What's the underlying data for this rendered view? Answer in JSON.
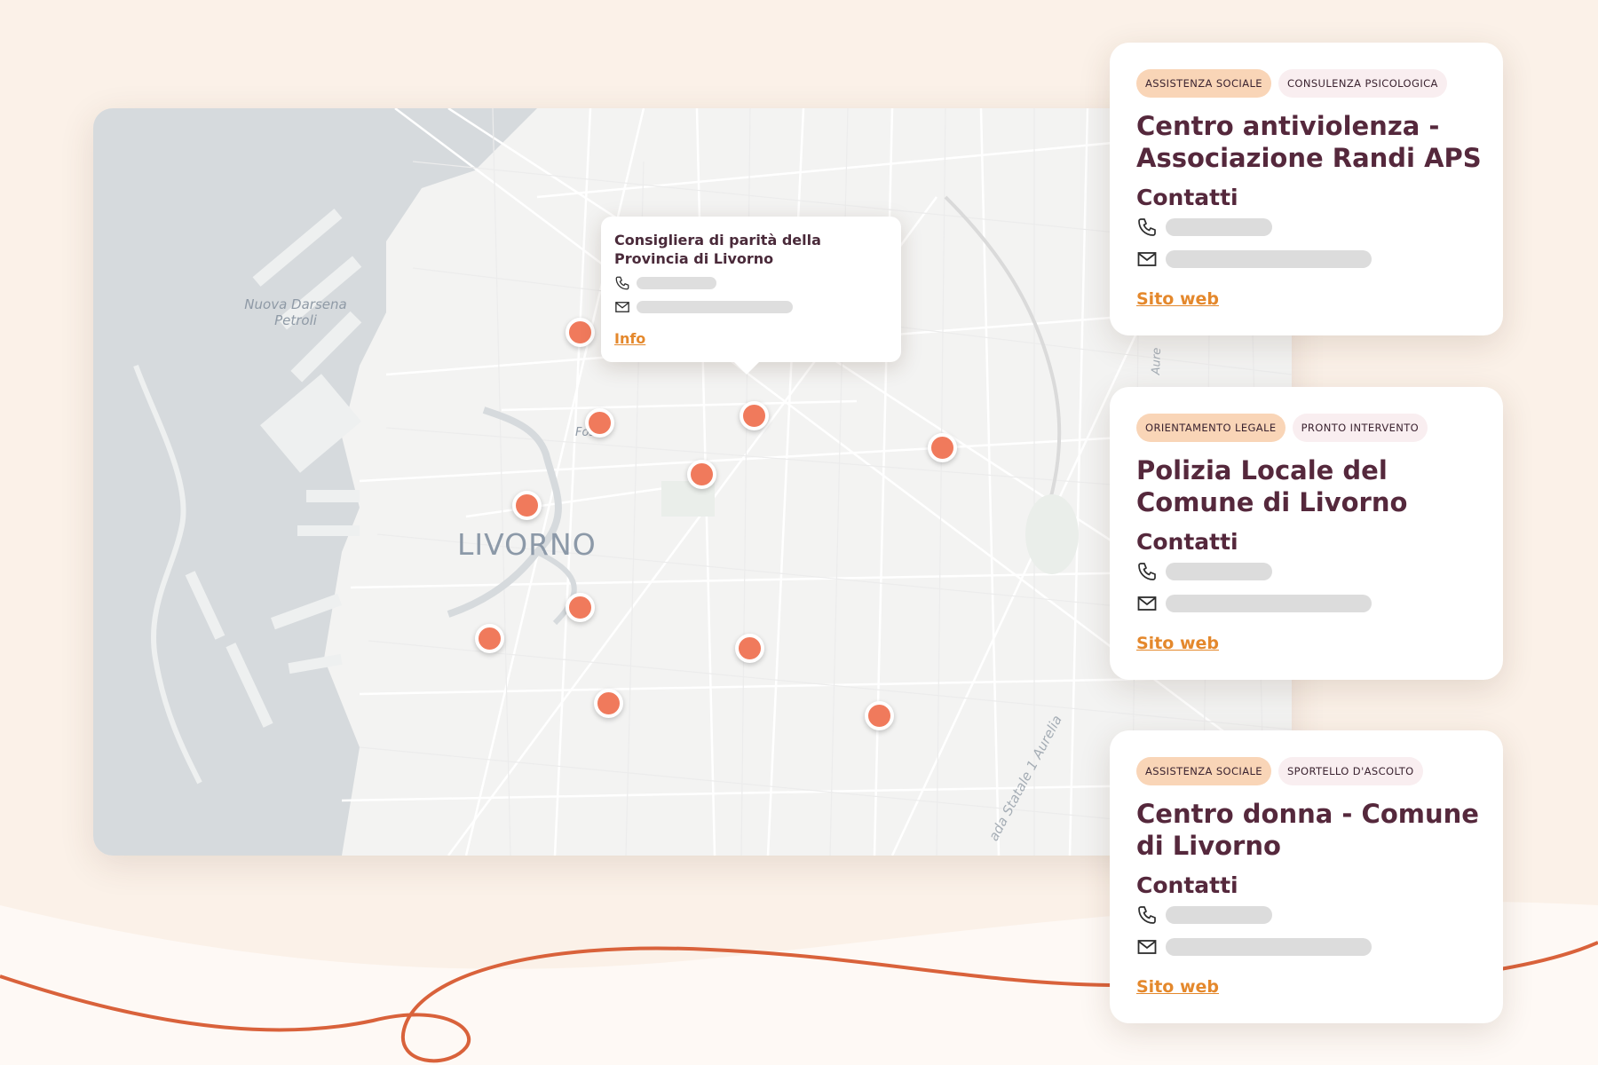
{
  "map": {
    "city_label": "LIVORNO",
    "place_labels": {
      "darsena": "Nuova Darsena Petroli",
      "fossi": "Fossi",
      "aurelia": "ada Statale 1 Aurelia",
      "aure": "Aure"
    },
    "popup": {
      "title": "Consigliera di parità della Provincia di Livorno",
      "link_label": "Info"
    }
  },
  "cards": [
    {
      "tags": [
        "ASSISTENZA SOCIALE",
        "CONSULENZA PSICOLOGICA"
      ],
      "title": "Centro antiviolenza - Associazione Randi APS",
      "contacts_heading": "Contatti",
      "link_label": "Sito web"
    },
    {
      "tags": [
        "ORIENTAMENTO LEGALE",
        "PRONTO INTERVENTO"
      ],
      "title": "Polizia Locale del Comune di Livorno",
      "contacts_heading": "Contatti",
      "link_label": "Sito web"
    },
    {
      "tags": [
        "ASSISTENZA SOCIALE",
        "SPORTELLO D'ASCOLTO"
      ],
      "title": "Centro donna - Comune di Livorno",
      "contacts_heading": "Contatti",
      "link_label": "Sito web"
    }
  ],
  "icons": {
    "phone": "phone-icon",
    "mail": "mail-icon",
    "map_pin": "map-pin-icon"
  },
  "colors": {
    "background": "#fbf1e8",
    "pin": "#f07a5c",
    "link": "#e4882c",
    "title": "#55283c",
    "tag_primary": "#f9d5b7",
    "tag_secondary": "#f9eef0",
    "decorative_line": "#d9623b"
  }
}
